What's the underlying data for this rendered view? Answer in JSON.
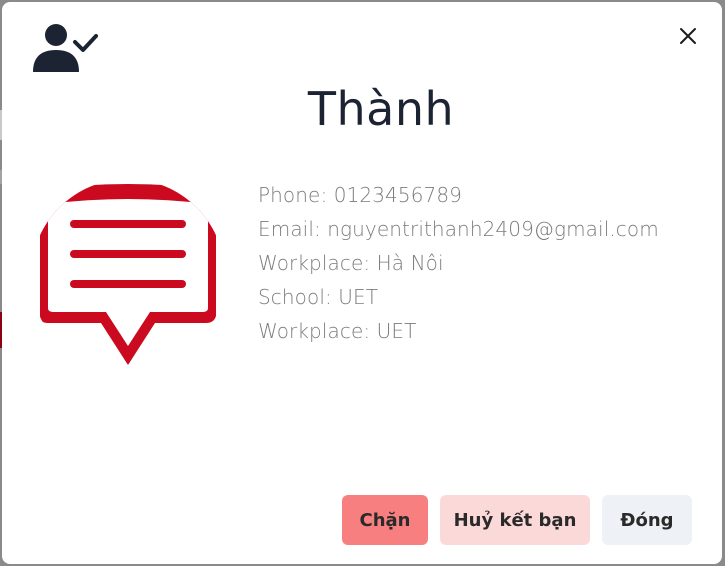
{
  "modal": {
    "header_icon": "user-check-icon",
    "close_icon": "close-icon",
    "title": "Thành"
  },
  "profile": {
    "avatar_icon": "chat-bubble-icon",
    "phone": "Phone: 0123456789",
    "email": "Email: nguyentrithanh2409@gmail.com",
    "workplace": "Workplace: Hà Nôi",
    "school": "School: UET",
    "workplace2": "Workplace: UET"
  },
  "footer": {
    "block_label": "Chặn",
    "unfriend_label": "Huỷ kết bạn",
    "close_label": "Đóng"
  },
  "colors": {
    "block_button": "#f87f7f",
    "unfriend_button": "#fcd9d9",
    "close_button": "#eef1f5",
    "avatar_red": "#cc0a1f"
  }
}
